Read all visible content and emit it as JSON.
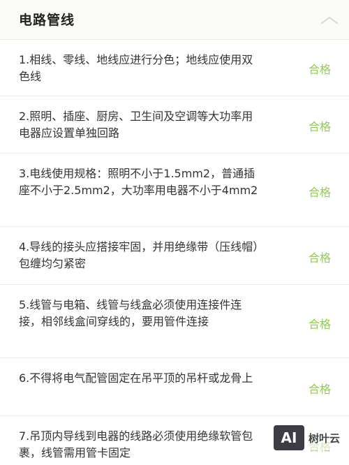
{
  "header": {
    "title": "电路管线"
  },
  "items": [
    {
      "text": "1.相线、零线、地线应进行分色；地线应使用双色线",
      "status": "合格"
    },
    {
      "text": "2.照明、插座、厨房、卫生间及空调等大功率用电器应设置单独回路",
      "status": "合格"
    },
    {
      "text": "3.电线使用规格：照明不小于1.5mm2，普通插座不小于2.5mm2，大功率用电器不小于4mm2",
      "status": "合格"
    },
    {
      "text": "4.导线的接头应搭接牢固，并用绝缘带（压线帽）包缠均匀紧密",
      "status": "合格"
    },
    {
      "text": "5.线管与电箱、线管与线盒必须使用连接件连接，相邻线盒间穿线的，要用管件连接",
      "status": "合格"
    },
    {
      "text": "6.不得将电气配管固定在吊平顶的吊杆或龙骨上",
      "status": "合格"
    },
    {
      "text": "7.吊顶内导线到电器的线路必须使用绝缘软管包裹，线管需用管卡固定",
      "status": "合格"
    }
  ],
  "watermark": {
    "logo": "AI",
    "brand": "树叶云"
  },
  "colors": {
    "status": "#8ed049",
    "header_bg": "#fbfbf7"
  }
}
